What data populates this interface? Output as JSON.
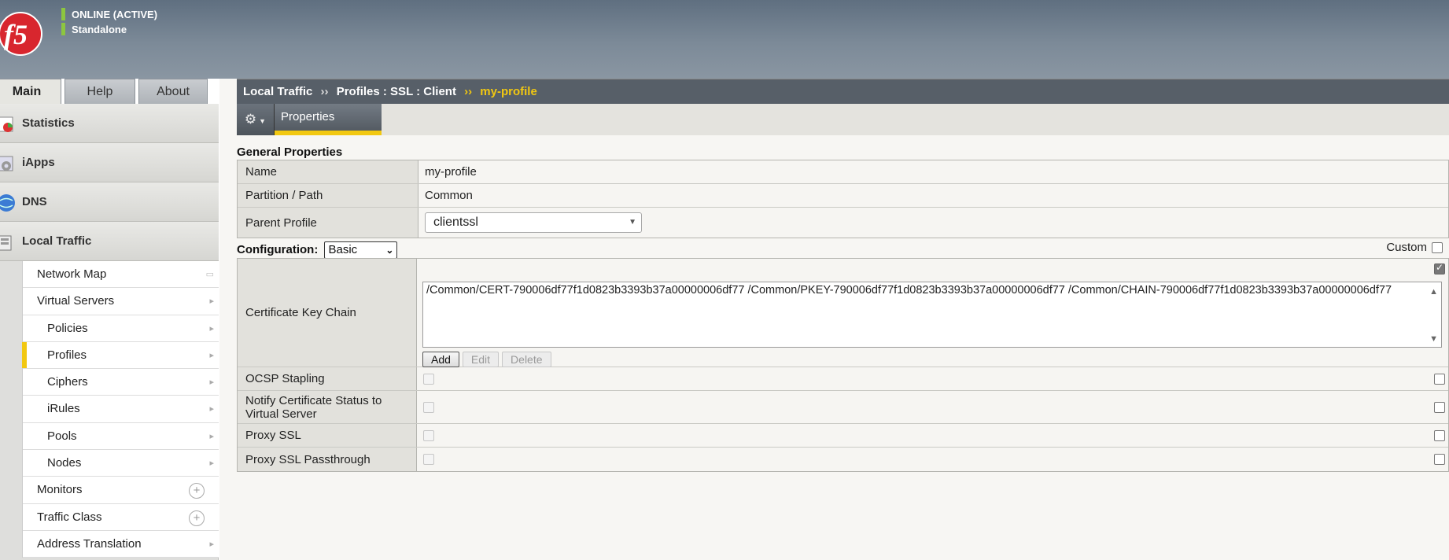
{
  "header": {
    "logo_text": "f5",
    "status": "ONLINE (ACTIVE)",
    "mode": "Standalone"
  },
  "tabs": [
    {
      "label": "Main",
      "active": true
    },
    {
      "label": "Help",
      "active": false
    },
    {
      "label": "About",
      "active": false
    }
  ],
  "nav": {
    "sections": [
      {
        "label": "Statistics",
        "icon": "statistics-icon"
      },
      {
        "label": "iApps",
        "icon": "iapps-icon"
      },
      {
        "label": "DNS",
        "icon": "dns-icon"
      },
      {
        "label": "Local Traffic",
        "icon": "local-traffic-icon"
      }
    ],
    "items": [
      {
        "label": "Network Map"
      },
      {
        "label": "Virtual Servers"
      },
      {
        "label": "Policies"
      },
      {
        "label": "Profiles"
      },
      {
        "label": "Ciphers"
      },
      {
        "label": "iRules"
      },
      {
        "label": "Pools"
      },
      {
        "label": "Nodes"
      },
      {
        "label": "Monitors"
      },
      {
        "label": "Traffic Class"
      },
      {
        "label": "Address Translation"
      }
    ]
  },
  "breadcrumb": {
    "part1": "Local Traffic",
    "sep": "››",
    "part2": "Profiles : SSL : Client",
    "current": "my-profile"
  },
  "toolbar": {
    "properties_tab": "Properties"
  },
  "general": {
    "title": "General Properties",
    "name_label": "Name",
    "name_value": "my-profile",
    "partition_label": "Partition / Path",
    "partition_value": "Common",
    "parent_label": "Parent Profile",
    "parent_value": "clientssl"
  },
  "configuration": {
    "label": "Configuration:",
    "mode_value": "Basic",
    "custom_label": "Custom",
    "cert_label": "Certificate Key Chain",
    "cert_value": "/Common/CERT-790006df77f1d0823b3393b37a00000006df77 /Common/PKEY-790006df77f1d0823b3393b37a00000006df77 /Common/CHAIN-790006df77f1d0823b3393b37a00000006df77",
    "add_label": "Add",
    "edit_label": "Edit",
    "delete_label": "Delete",
    "ocsp_label": "OCSP Stapling",
    "notify_label": "Notify Certificate Status to Virtual Server",
    "proxy_label": "Proxy SSL",
    "passthrough_label": "Proxy SSL Passthrough"
  },
  "colors": {
    "accent": "#f2c811",
    "status_green": "#8dc63f"
  }
}
